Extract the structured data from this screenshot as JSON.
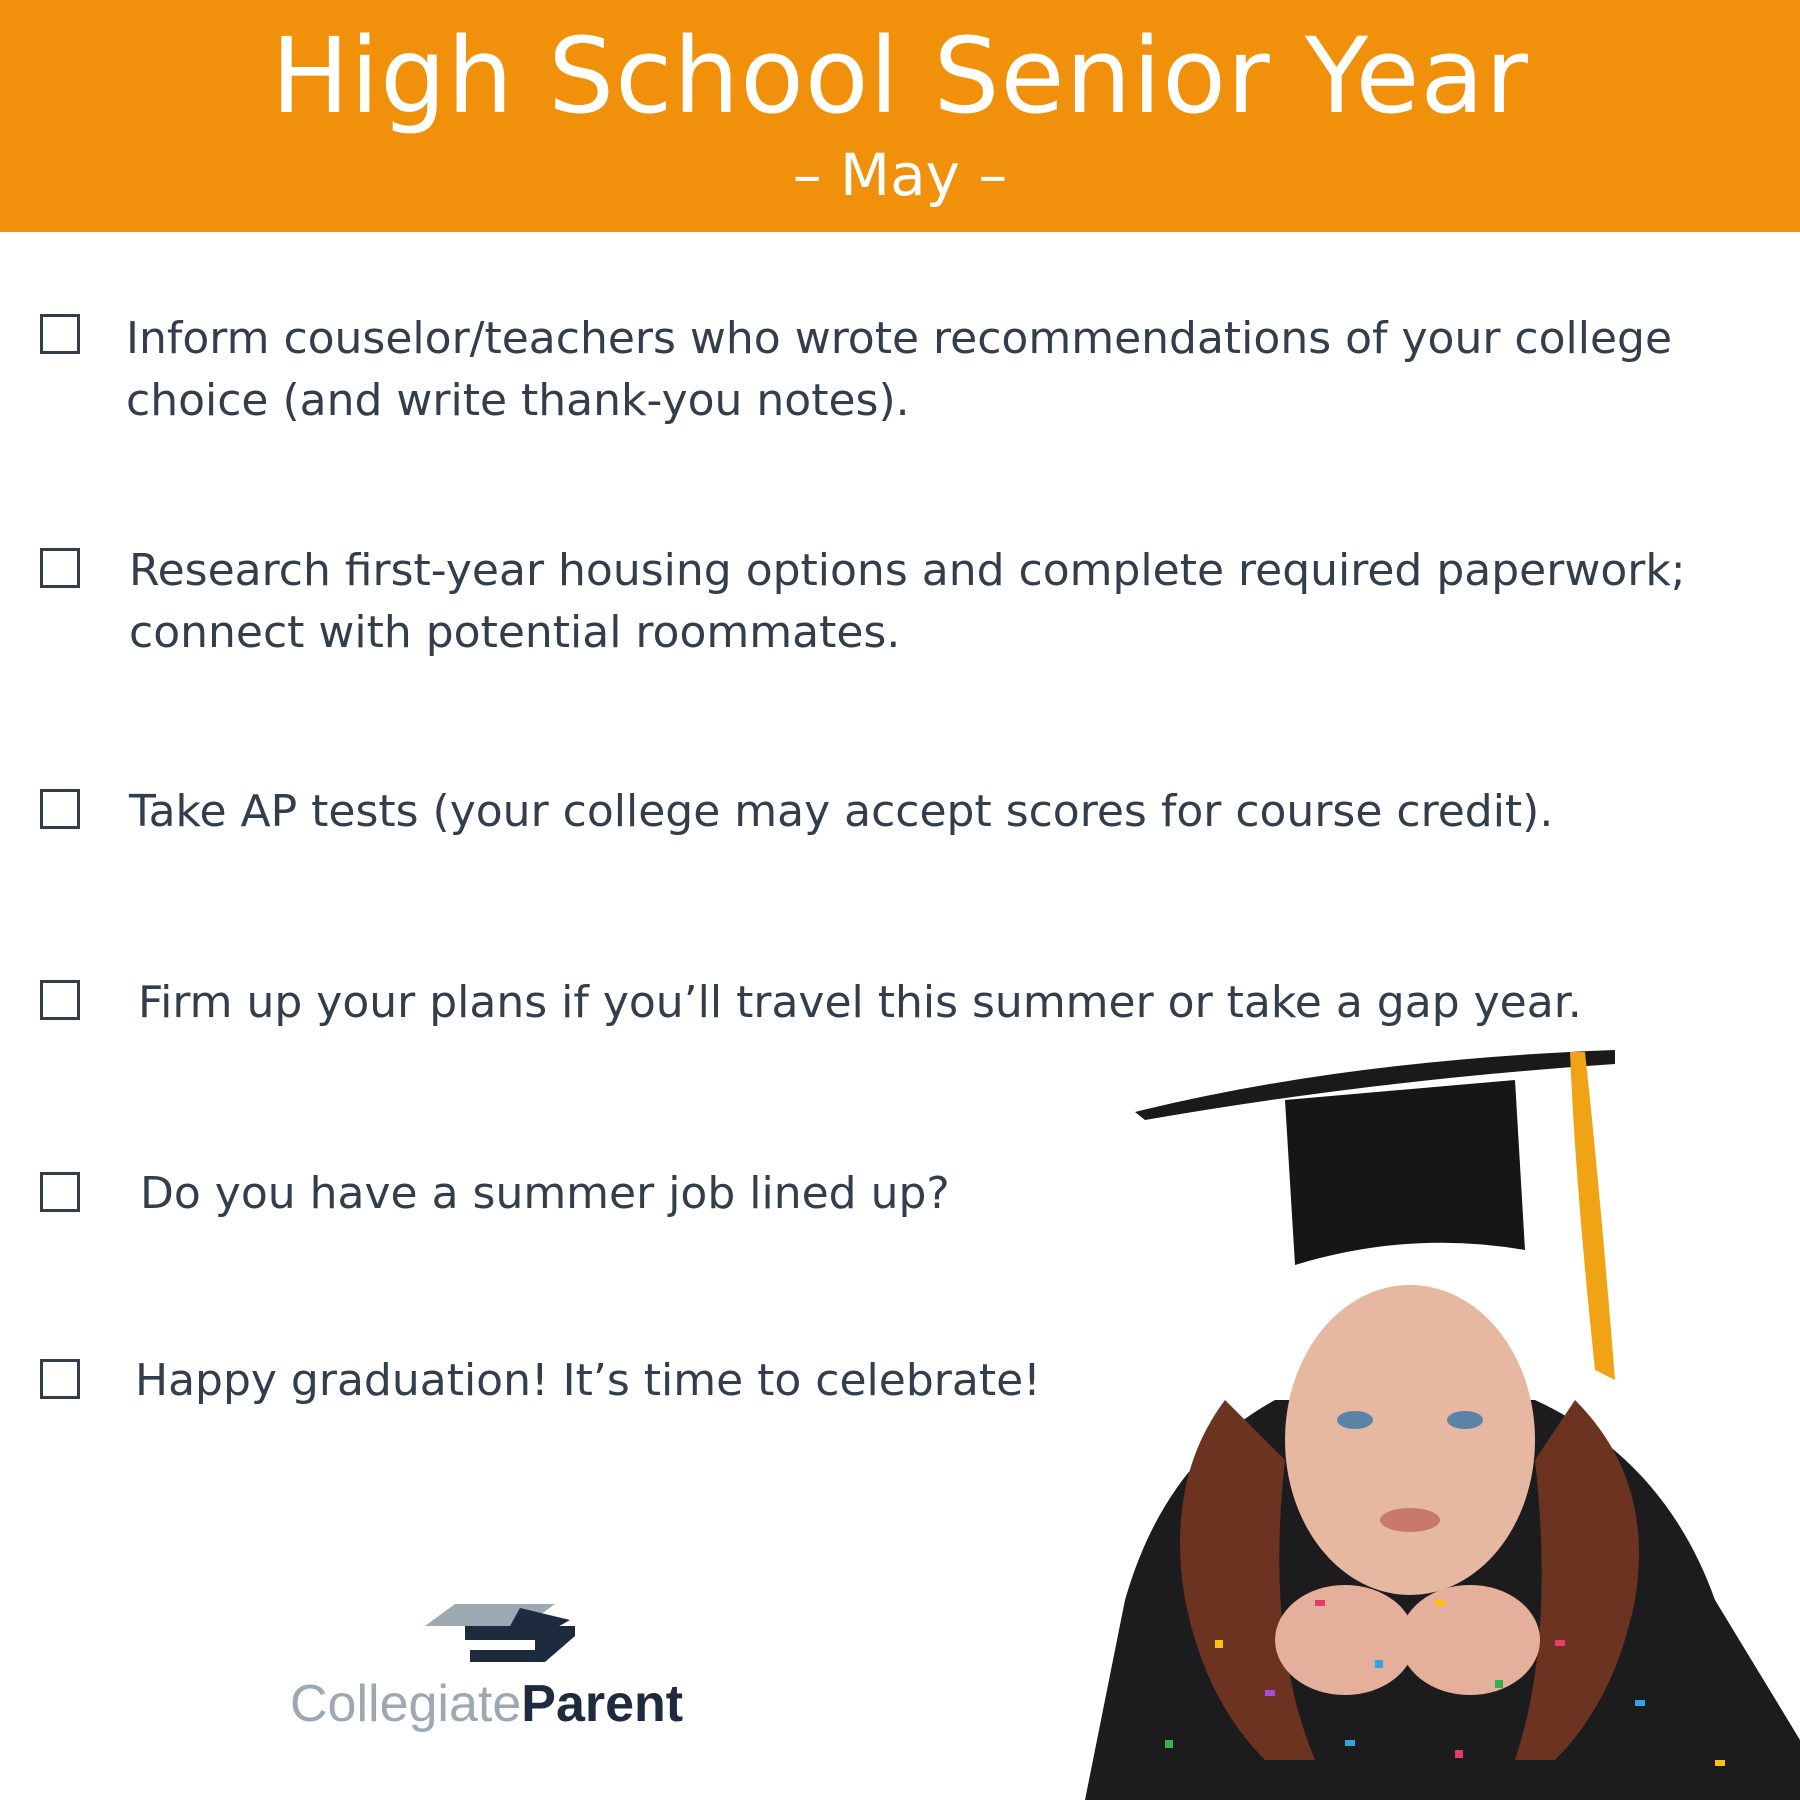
{
  "header": {
    "title": "High School Senior Year",
    "subtitle": "– May –"
  },
  "checklist": [
    {
      "line1": "Inform couselor/teachers who wrote recommendations of your college",
      "line2": "choice (and write thank-you notes)."
    },
    {
      "line1": "Research first-year housing options and complete required paperwork;",
      "line2": "connect with potential roommates."
    },
    {
      "line1": "Take AP tests (your college may accept scores for course credit).",
      "line2": ""
    },
    {
      "line1": "Firm up your plans if you’ll travel this summer or take a gap year.",
      "line2": ""
    },
    {
      "line1": "Do you have a summer job lined up?",
      "line2": ""
    },
    {
      "line1": "Happy graduation! It’s time to celebrate!",
      "line2": ""
    }
  ],
  "logo": {
    "light": "Collegiate",
    "bold": "Parent"
  },
  "colors": {
    "accent": "#f0900b",
    "text": "#333e4c",
    "logo_dark": "#1e2a3d",
    "logo_light": "#9ea8b2"
  }
}
